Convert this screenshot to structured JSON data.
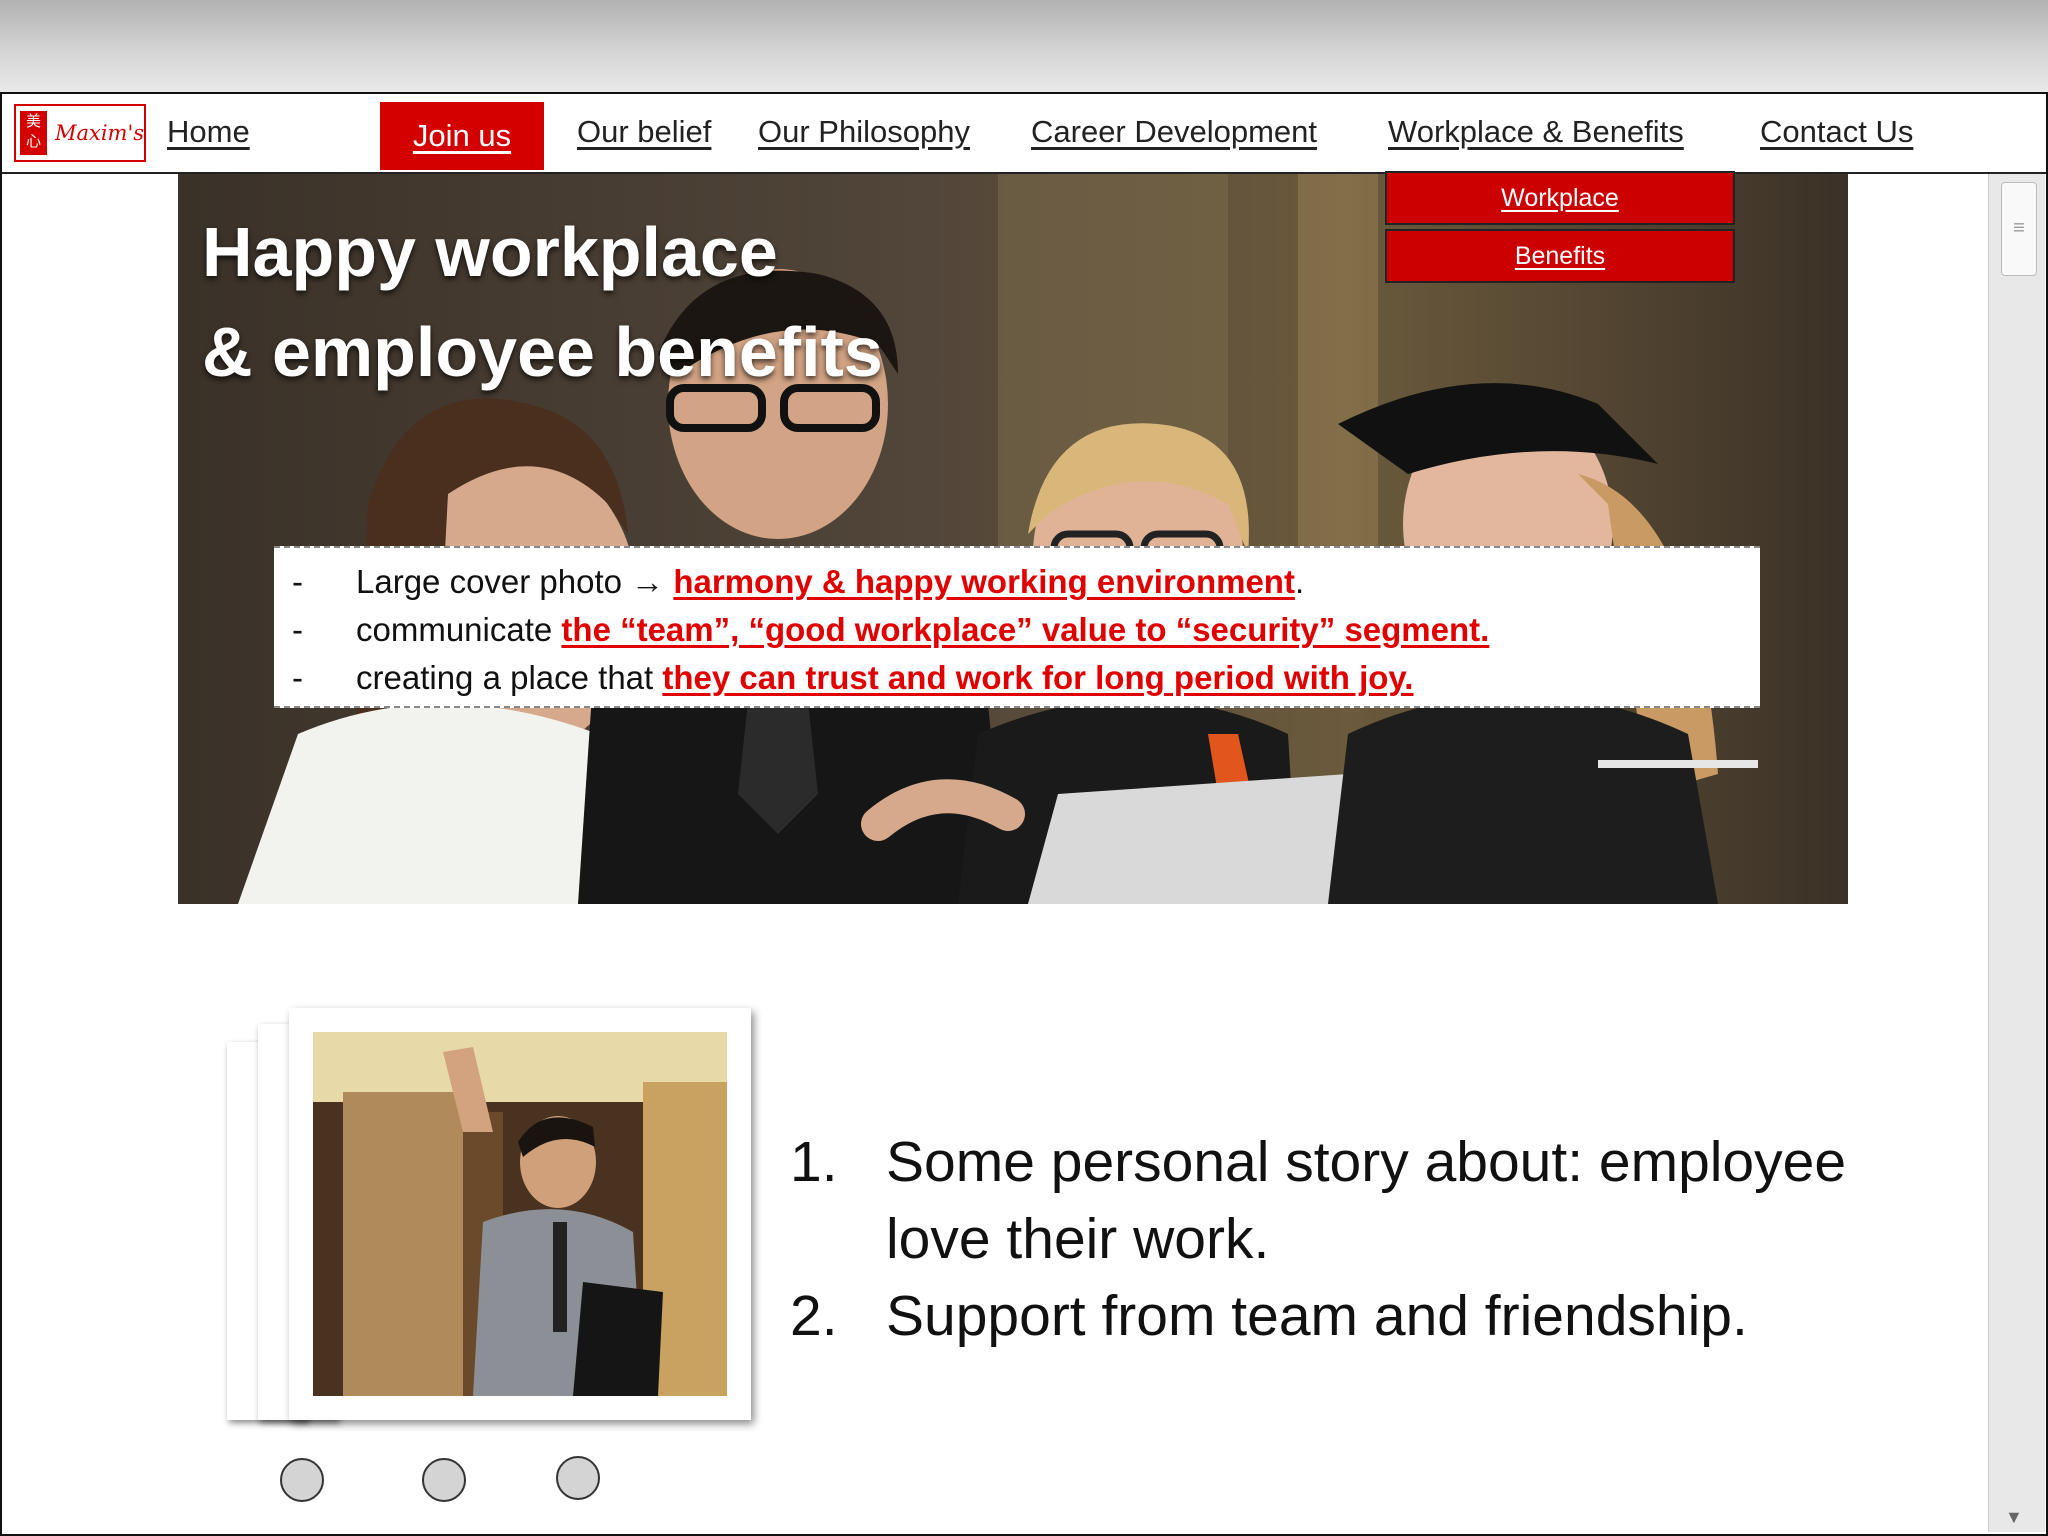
{
  "logo": {
    "seal": "美心",
    "wordmark": "Maxim's"
  },
  "nav": {
    "items": [
      {
        "label": "Home"
      },
      {
        "label": "Join us"
      },
      {
        "label": "Our belief"
      },
      {
        "label": "Our Philosophy"
      },
      {
        "label": "Career Development"
      },
      {
        "label": "Workplace & Benefits"
      },
      {
        "label": "Contact Us"
      }
    ],
    "dropdown": [
      {
        "label": "Workplace"
      },
      {
        "label": "Benefits"
      }
    ]
  },
  "hero": {
    "title_line1": "Happy workplace",
    "title_line2": "& employee benefits"
  },
  "notes": [
    {
      "bullet": "-",
      "plain": "Large cover photo → ",
      "highlight": "harmony & happy working environment",
      "after": "."
    },
    {
      "bullet": "-",
      "plain": "communicate ",
      "highlight": "the “team”, “good workplace” value to “security” segment.",
      "after": ""
    },
    {
      "bullet": "-",
      "plain": "creating a place that ",
      "highlight": "they can trust and work for long period with joy.",
      "after": ""
    }
  ],
  "story": [
    {
      "num": "1.",
      "line1": "Some personal story about: employee",
      "line2": "love their work."
    },
    {
      "num": "2.",
      "line1": "Support from team and friendship.",
      "line2": ""
    }
  ],
  "colors": {
    "brand_red": "#d40000",
    "highlight_red": "#e00000"
  },
  "icons": {
    "scroll_grip": "≡",
    "scroll_down": "▼"
  }
}
